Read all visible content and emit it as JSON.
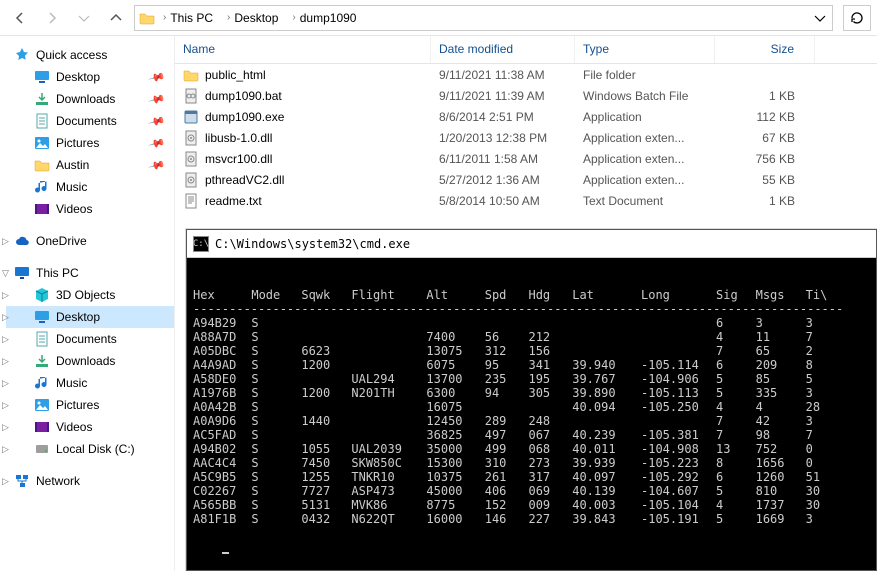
{
  "breadcrumb": {
    "root_icon": "pc",
    "items": [
      "This PC",
      "Desktop",
      "dump1090"
    ]
  },
  "sidebar": {
    "quick": {
      "label": "Quick access",
      "items": [
        {
          "icon": "desktop",
          "label": "Desktop",
          "pinned": true
        },
        {
          "icon": "download",
          "label": "Downloads",
          "pinned": true
        },
        {
          "icon": "doc",
          "label": "Documents",
          "pinned": true
        },
        {
          "icon": "pic",
          "label": "Pictures",
          "pinned": true
        },
        {
          "icon": "folder",
          "label": "Austin",
          "pinned": true
        },
        {
          "icon": "mus",
          "label": "Music",
          "pinned": false
        },
        {
          "icon": "vid",
          "label": "Videos",
          "pinned": false
        }
      ]
    },
    "onedrive": {
      "icon": "cloud",
      "label": "OneDrive"
    },
    "thispc": {
      "icon": "pc",
      "label": "This PC",
      "items": [
        {
          "icon": "3d",
          "label": "3D Objects"
        },
        {
          "icon": "desktop",
          "label": "Desktop",
          "selected": true
        },
        {
          "icon": "doc",
          "label": "Documents"
        },
        {
          "icon": "download",
          "label": "Downloads"
        },
        {
          "icon": "mus",
          "label": "Music"
        },
        {
          "icon": "pic",
          "label": "Pictures"
        },
        {
          "icon": "vid",
          "label": "Videos"
        },
        {
          "icon": "disk",
          "label": "Local Disk (C:)"
        }
      ]
    },
    "network": {
      "icon": "net",
      "label": "Network"
    }
  },
  "columns": {
    "name": "Name",
    "date": "Date modified",
    "type": "Type",
    "size": "Size"
  },
  "files": [
    {
      "icon": "folder",
      "name": "public_html",
      "date": "9/11/2021 11:38 AM",
      "type": "File folder",
      "size": ""
    },
    {
      "icon": "bat",
      "name": "dump1090.bat",
      "date": "9/11/2021 11:39 AM",
      "type": "Windows Batch File",
      "size": "1 KB"
    },
    {
      "icon": "exe",
      "name": "dump1090.exe",
      "date": "8/6/2014 2:51 PM",
      "type": "Application",
      "size": "112 KB"
    },
    {
      "icon": "dll",
      "name": "libusb-1.0.dll",
      "date": "1/20/2013 12:38 PM",
      "type": "Application exten...",
      "size": "67 KB"
    },
    {
      "icon": "dll",
      "name": "msvcr100.dll",
      "date": "6/11/2011 1:58 AM",
      "type": "Application exten...",
      "size": "756 KB"
    },
    {
      "icon": "dll",
      "name": "pthreadVC2.dll",
      "date": "5/27/2012 1:36 AM",
      "type": "Application exten...",
      "size": "55 KB"
    },
    {
      "icon": "txt",
      "name": "readme.txt",
      "date": "5/8/2014 10:50 AM",
      "type": "Text Document",
      "size": "1 KB"
    }
  ],
  "cmd": {
    "title": "C:\\Windows\\system32\\cmd.exe",
    "headers": [
      "Hex",
      "Mode",
      "Sqwk",
      "Flight",
      "Alt",
      "Spd",
      "Hdg",
      "Lat",
      "Long",
      "Sig",
      "Msgs",
      "Ti\\"
    ],
    "rows": [
      {
        "hex": "A94B29",
        "mode": "S",
        "sqwk": "",
        "flt": "",
        "alt": "",
        "spd": "",
        "hdg": "",
        "lat": "",
        "lon": "",
        "sig": "6",
        "msgs": "3",
        "ti": "3"
      },
      {
        "hex": "A88A7D",
        "mode": "S",
        "sqwk": "",
        "flt": "",
        "alt": "7400",
        "spd": "56",
        "hdg": "212",
        "lat": "",
        "lon": "",
        "sig": "4",
        "msgs": "11",
        "ti": "7"
      },
      {
        "hex": "A05DBC",
        "mode": "S",
        "sqwk": "6623",
        "flt": "",
        "alt": "13075",
        "spd": "312",
        "hdg": "156",
        "lat": "",
        "lon": "",
        "sig": "7",
        "msgs": "65",
        "ti": "2"
      },
      {
        "hex": "A4A9AD",
        "mode": "S",
        "sqwk": "1200",
        "flt": "",
        "alt": "6075",
        "spd": "95",
        "hdg": "341",
        "lat": "39.940",
        "lon": "-105.114",
        "sig": "6",
        "msgs": "209",
        "ti": "8"
      },
      {
        "hex": "A58DE0",
        "mode": "S",
        "sqwk": "",
        "flt": "UAL294",
        "alt": "13700",
        "spd": "235",
        "hdg": "195",
        "lat": "39.767",
        "lon": "-104.906",
        "sig": "5",
        "msgs": "85",
        "ti": "5"
      },
      {
        "hex": "A1976B",
        "mode": "S",
        "sqwk": "1200",
        "flt": "N201TH",
        "alt": "6300",
        "spd": "94",
        "hdg": "305",
        "lat": "39.890",
        "lon": "-105.113",
        "sig": "5",
        "msgs": "335",
        "ti": "3"
      },
      {
        "hex": "A0A42B",
        "mode": "S",
        "sqwk": "",
        "flt": "",
        "alt": "16075",
        "spd": "",
        "hdg": "",
        "lat": "40.094",
        "lon": "-105.250",
        "sig": "4",
        "msgs": "4",
        "ti": "28"
      },
      {
        "hex": "A0A9D6",
        "mode": "S",
        "sqwk": "1440",
        "flt": "",
        "alt": "12450",
        "spd": "289",
        "hdg": "248",
        "lat": "",
        "lon": "",
        "sig": "7",
        "msgs": "42",
        "ti": "3"
      },
      {
        "hex": "AC5FAD",
        "mode": "S",
        "sqwk": "",
        "flt": "",
        "alt": "36825",
        "spd": "497",
        "hdg": "067",
        "lat": "40.239",
        "lon": "-105.381",
        "sig": "7",
        "msgs": "98",
        "ti": "7"
      },
      {
        "hex": "A94B02",
        "mode": "S",
        "sqwk": "1055",
        "flt": "UAL2039",
        "alt": "35000",
        "spd": "499",
        "hdg": "068",
        "lat": "40.011",
        "lon": "-104.908",
        "sig": "13",
        "msgs": "752",
        "ti": "0"
      },
      {
        "hex": "AAC4C4",
        "mode": "S",
        "sqwk": "7450",
        "flt": "SKW850C",
        "alt": "15300",
        "spd": "310",
        "hdg": "273",
        "lat": "39.939",
        "lon": "-105.223",
        "sig": "8",
        "msgs": "1656",
        "ti": "0"
      },
      {
        "hex": "A5C9B5",
        "mode": "S",
        "sqwk": "1255",
        "flt": "TNKR10",
        "alt": "10375",
        "spd": "261",
        "hdg": "317",
        "lat": "40.097",
        "lon": "-105.292",
        "sig": "6",
        "msgs": "1260",
        "ti": "51"
      },
      {
        "hex": "C02267",
        "mode": "S",
        "sqwk": "7727",
        "flt": "ASP473",
        "alt": "45000",
        "spd": "406",
        "hdg": "069",
        "lat": "40.139",
        "lon": "-104.607",
        "sig": "5",
        "msgs": "810",
        "ti": "30"
      },
      {
        "hex": "A565BB",
        "mode": "S",
        "sqwk": "5131",
        "flt": "MVK86",
        "alt": "8775",
        "spd": "152",
        "hdg": "009",
        "lat": "40.003",
        "lon": "-105.104",
        "sig": "4",
        "msgs": "1737",
        "ti": "30"
      },
      {
        "hex": "A81F1B",
        "mode": "S",
        "sqwk": "0432",
        "flt": "N622QT",
        "alt": "16000",
        "spd": "146",
        "hdg": "227",
        "lat": "39.843",
        "lon": "-105.191",
        "sig": "5",
        "msgs": "1669",
        "ti": "3"
      }
    ]
  }
}
